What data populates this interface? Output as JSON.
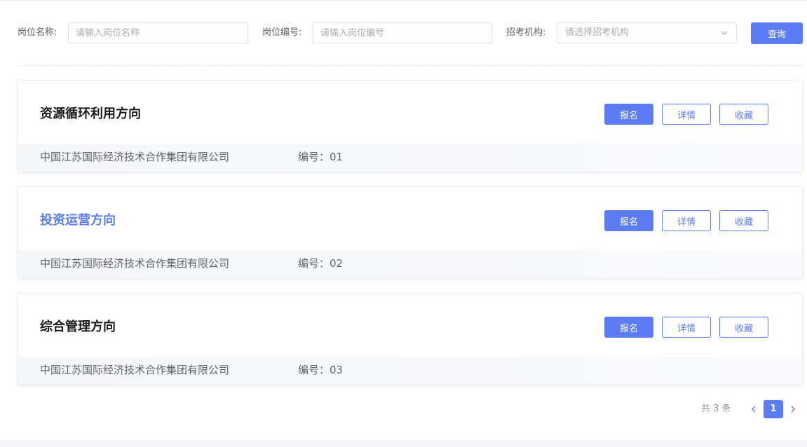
{
  "filters": {
    "position_name": {
      "label": "岗位名称:",
      "placeholder": "请输入岗位名称",
      "value": ""
    },
    "position_code": {
      "label": "岗位编号:",
      "placeholder": "请输入岗位编号",
      "value": ""
    },
    "institution": {
      "label": "招考机构:",
      "placeholder": "请选择招考机构",
      "value": ""
    },
    "query_label": "查询"
  },
  "jobs": [
    {
      "title": "资源循环利用方向",
      "org": "中国江苏国际经济技术合作集团有限公司",
      "code": "编号：01",
      "apply_label": "报名",
      "detail_label": "详情",
      "favorite_label": "收藏",
      "active": false
    },
    {
      "title": "投资运营方向",
      "org": "中国江苏国际经济技术合作集团有限公司",
      "code": "编号：02",
      "apply_label": "报名",
      "detail_label": "详情",
      "favorite_label": "收藏",
      "active": true
    },
    {
      "title": "综合管理方向",
      "org": "中国江苏国际经济技术合作集团有限公司",
      "code": "编号：03",
      "apply_label": "报名",
      "detail_label": "详情",
      "favorite_label": "收藏",
      "active": false
    }
  ],
  "pagination": {
    "total_text": "共 3 条",
    "current_page": "1",
    "prev_icon": "chevron-left-icon",
    "next_icon": "chevron-right-icon"
  },
  "colors": {
    "primary": "#5b7cf5",
    "text": "#303133",
    "muted": "#606266"
  }
}
